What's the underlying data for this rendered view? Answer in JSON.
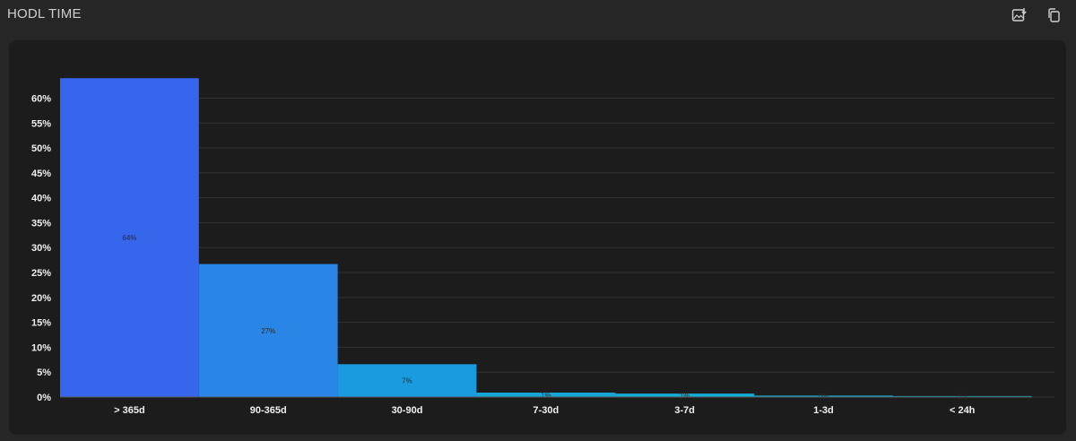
{
  "header": {
    "title": "HODL TIME",
    "download_icon": "image-download-icon",
    "copy_icon": "copy-icon"
  },
  "chart_data": {
    "type": "bar",
    "title": "HODL TIME",
    "categories": [
      "> 365d",
      "90-365d",
      "30-90d",
      "7-30d",
      "3-7d",
      "1-3d",
      "< 24h"
    ],
    "values": [
      64,
      27,
      7,
      1,
      1,
      0,
      0
    ],
    "plotted_values": [
      64,
      26.7,
      6.6,
      0.9,
      0.7,
      0.3,
      0.2
    ],
    "value_labels": [
      "64%",
      "27%",
      "7%",
      "1%",
      "1%",
      "0%",
      "0%"
    ],
    "bar_colors": [
      "#3566ec",
      "#2985e6",
      "#1a9be0",
      "#15a6d8",
      "#14acd4",
      "#12b0cf",
      "#12b0cc"
    ],
    "yticks": [
      "0%",
      "5%",
      "10%",
      "15%",
      "20%",
      "25%",
      "30%",
      "35%",
      "40%",
      "45%",
      "50%",
      "55%",
      "60%"
    ],
    "ylim": [
      0,
      65
    ],
    "xlabel": "",
    "ylabel": "",
    "grid": true,
    "legend": "none"
  },
  "colors": {
    "page_bg": "#262626",
    "panel_bg": "#1c1c1c",
    "grid": "#333333",
    "axis": "#555555"
  }
}
